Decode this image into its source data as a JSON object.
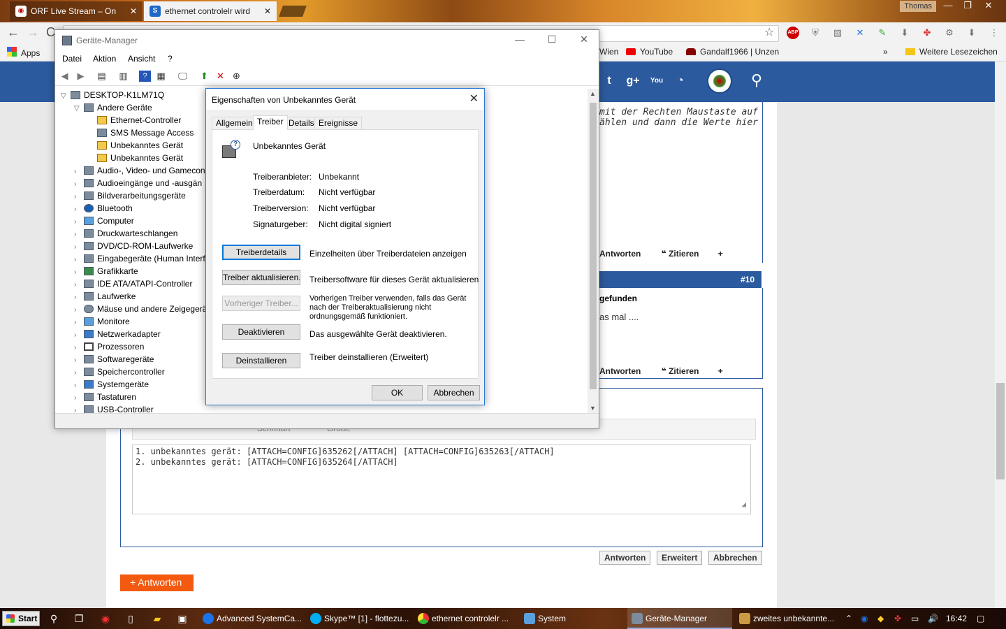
{
  "browser": {
    "tabs": [
      {
        "title": "ORF Live Stream – On",
        "favicon": "orf-icon"
      },
      {
        "title": "ethernet controlelr wird",
        "favicon": "forum-icon"
      }
    ],
    "user": "Thomas",
    "window_controls": {
      "minimize": "—",
      "maximize": "❐",
      "close": "✕"
    },
    "nav": {
      "back": "←",
      "forward": "→",
      "reload": "C"
    },
    "star": "☆",
    "bookmarks": {
      "apps": "Apps",
      "items": [
        "Wien",
        "YouTube",
        "Gandalf1966 | Unzen"
      ],
      "more": "»",
      "other": "Weitere Lesezeichen"
    },
    "extensions": [
      "ABP",
      "shield",
      "image",
      "translate",
      "script",
      "download",
      "pinwheel",
      "gear",
      "download2",
      "menu"
    ]
  },
  "forum": {
    "post1_lines": [
      "mit der Rechten Maustaste auf",
      "ählen und dann die Werte hier"
    ],
    "post_actions": {
      "reply": "Antworten",
      "quote": "Zitieren",
      "more": "+"
    },
    "post10_number": "#10",
    "post10_title": "gefunden",
    "post10_text": "as mal ....",
    "editor": {
      "font_label": "Schriftart",
      "size_label": "Größe",
      "lines": [
        "1. unbekanntes gerät: [ATTACH=CONFIG]635262[/ATTACH] [ATTACH=CONFIG]635263[/ATTACH]",
        "2. unbekanntes gerät: [ATTACH=CONFIG]635264[/ATTACH]"
      ]
    },
    "buttons": {
      "reply": "Antworten",
      "advanced": "Erweitert",
      "cancel": "Abbrechen"
    },
    "answer_button": "+ Antworten"
  },
  "device_manager": {
    "title": "Geräte-Manager",
    "menu": [
      "Datei",
      "Aktion",
      "Ansicht",
      "?"
    ],
    "tree": {
      "root": "DESKTOP-K1LM71Q",
      "other_devices": "Andere Geräte",
      "other_children": [
        "Ethernet-Controller",
        "SMS Message Access",
        "Unbekanntes Gerät",
        "Unbekanntes Gerät"
      ],
      "categories": [
        "Audio-, Video- und Gamecon",
        "Audioeingänge und -ausgän",
        "Bildverarbeitungsgeräte",
        "Bluetooth",
        "Computer",
        "Druckwarteschlangen",
        "DVD/CD-ROM-Laufwerke",
        "Eingabegeräte (Human Interf",
        "Grafikkarte",
        "IDE ATA/ATAPI-Controller",
        "Laufwerke",
        "Mäuse und andere Zeigegerä",
        "Monitore",
        "Netzwerkadapter",
        "Prozessoren",
        "Softwaregeräte",
        "Speichercontroller",
        "Systemgeräte",
        "Tastaturen",
        "USB-Controller"
      ]
    }
  },
  "dialog": {
    "title": "Eigenschaften von Unbekanntes Gerät",
    "tabs": [
      "Allgemein",
      "Treiber",
      "Details",
      "Ereignisse"
    ],
    "device_name": "Unbekanntes Gerät",
    "fields": [
      {
        "label": "Treiberanbieter:",
        "value": "Unbekannt"
      },
      {
        "label": "Treiberdatum:",
        "value": "Nicht verfügbar"
      },
      {
        "label": "Treiberversion:",
        "value": "Nicht verfügbar"
      },
      {
        "label": "Signaturgeber:",
        "value": "Nicht digital signiert"
      }
    ],
    "actions": [
      {
        "button": "Treiberdetails",
        "desc": "Einzelheiten über Treiberdateien anzeigen"
      },
      {
        "button": "Treiber aktualisieren...",
        "desc": "Treibersoftware für dieses Gerät aktualisieren"
      },
      {
        "button": "Vorheriger Treiber...",
        "desc": "Vorherigen Treiber verwenden, falls das Gerät nach der Treiberaktualisierung nicht ordnungsgemäß funktioniert."
      },
      {
        "button": "Deaktivieren",
        "desc": "Das ausgewählte Gerät deaktivieren."
      },
      {
        "button": "Deinstallieren",
        "desc": "Treiber deinstallieren (Erweitert)"
      }
    ],
    "ok": "OK",
    "cancel": "Abbrechen"
  },
  "taskbar": {
    "start": "Start",
    "tasks": [
      "Advanced SystemCa...",
      "Skype™ [1] - flottezu...",
      "ethernet controlelr ...",
      "System",
      "Geräte-Manager",
      "zweites unbekannte..."
    ],
    "time": "16:42"
  }
}
